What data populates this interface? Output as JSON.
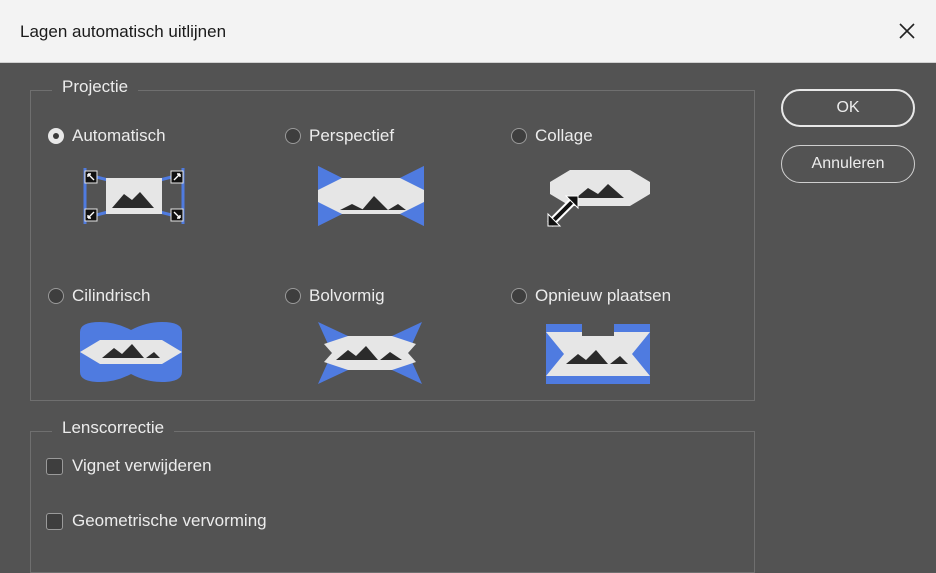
{
  "dialog": {
    "title": "Lagen automatisch uitlijnen"
  },
  "projection": {
    "legend": "Projectie",
    "options": [
      {
        "label": "Automatisch",
        "icon": "auto-projection-icon",
        "selected": true
      },
      {
        "label": "Perspectief",
        "icon": "perspective-projection-icon",
        "selected": false
      },
      {
        "label": "Collage",
        "icon": "collage-projection-icon",
        "selected": false
      },
      {
        "label": "Cilindrisch",
        "icon": "cylindrical-projection-icon",
        "selected": false
      },
      {
        "label": "Bolvormig",
        "icon": "spherical-projection-icon",
        "selected": false
      },
      {
        "label": "Opnieuw plaatsen",
        "icon": "reposition-projection-icon",
        "selected": false
      }
    ]
  },
  "lens": {
    "legend": "Lenscorrectie",
    "options": [
      {
        "label": "Vignet verwijderen",
        "checked": false
      },
      {
        "label": "Geometrische vervorming",
        "checked": false
      }
    ]
  },
  "buttons": {
    "ok": "OK",
    "cancel": "Annuleren"
  },
  "colors": {
    "accent": "#4f7be0",
    "panel": "#535353",
    "image_fill": "#e6e6e6",
    "mountain": "#2b2b2b"
  }
}
